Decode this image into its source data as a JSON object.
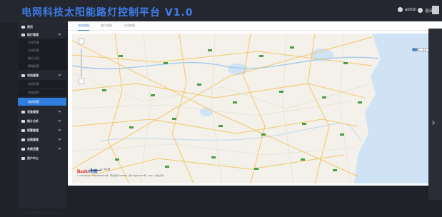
{
  "app": {
    "title": "电网科技太阳能路灯控制平台 V1.0"
  },
  "header": {
    "user_label": "admin",
    "logout_label": "退出"
  },
  "sidebar": {
    "items": [
      {
        "label": "首页"
      },
      {
        "label": "路灯管理"
      },
      {
        "label": "电站管理"
      },
      {
        "label": "设备管理"
      },
      {
        "label": "统计分析"
      },
      {
        "label": "报警管理"
      },
      {
        "label": "运维管理"
      },
      {
        "label": "系统设置"
      },
      {
        "label": "用户中心"
      }
    ],
    "subitems": [
      {
        "label": "灯杆列表"
      },
      {
        "label": "灯具列表"
      },
      {
        "label": "路灯分组"
      },
      {
        "label": "策略配置"
      },
      {
        "label": "电站列表"
      },
      {
        "label": "电站监控"
      },
      {
        "label": "电站地图"
      }
    ]
  },
  "tabs": [
    {
      "label": "电站地图"
    },
    {
      "label": "路灯地图"
    },
    {
      "label": "分组地图"
    }
  ],
  "map": {
    "logo_text": "Baidu",
    "logo_accent": "地图",
    "scale_label": "50公里",
    "copyright": "© 2019 Baidu - GS(2018)5572号 - 甲测资字1100930 - 京ICP证030173号 - Data © 长地万方"
  },
  "footer": {
    "text": "Copyright © 电网科技 All Rights Reserved"
  },
  "colors": {
    "accent": "#2f7ee0",
    "title": "#3d7de8",
    "bg": "#1f2229",
    "sidebar": "#252830"
  }
}
